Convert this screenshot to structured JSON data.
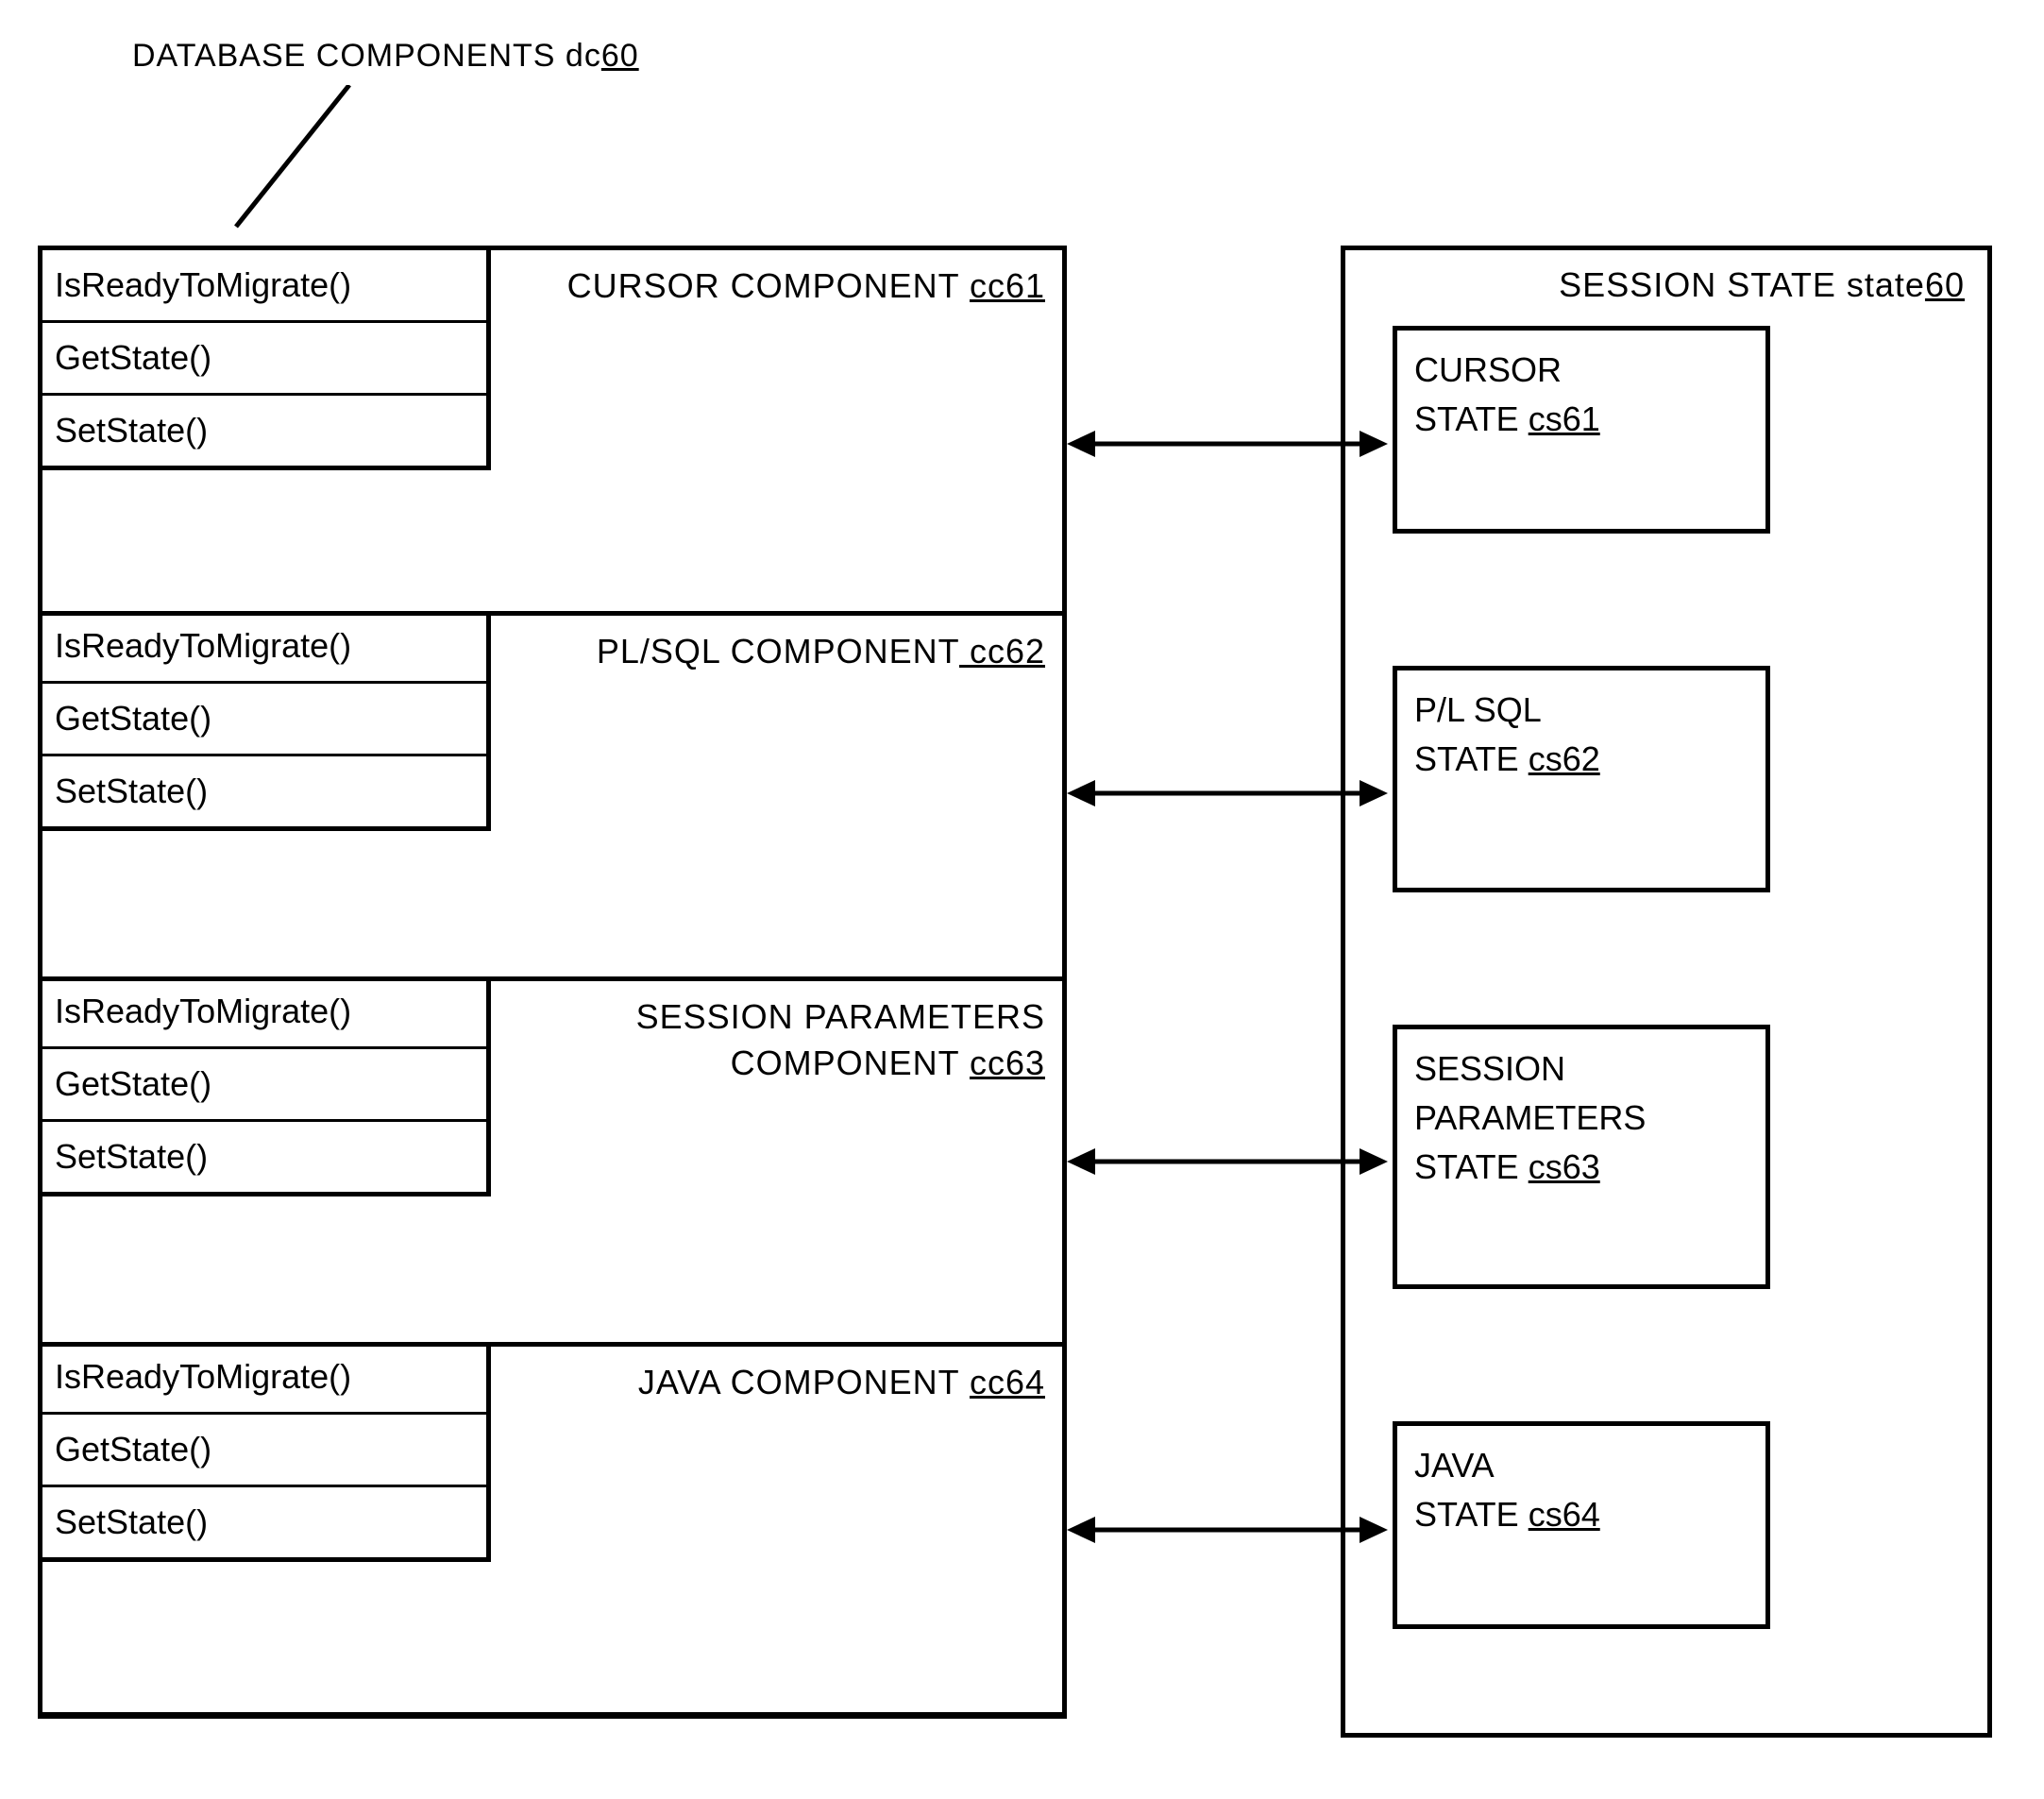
{
  "header": {
    "label": "DATABASE COMPONENTS dc",
    "ref": "60"
  },
  "components": [
    {
      "title": "CURSOR COMPONENT ",
      "ref": "cc61",
      "methods": [
        "IsReadyToMigrate()",
        "GetState()",
        "SetState()"
      ]
    },
    {
      "title": "PL/SQL COMPONENT",
      "ref": " cc62",
      "methods": [
        "IsReadyToMigrate()",
        "GetState()",
        "SetState()"
      ]
    },
    {
      "title_line1": "SESSION PARAMETERS",
      "title_line2": "COMPONENT ",
      "ref": "cc63",
      "methods": [
        "IsReadyToMigrate()",
        "GetState()",
        "SetState()"
      ]
    },
    {
      "title": "JAVA COMPONENT  ",
      "ref": "cc64",
      "methods": [
        "IsReadyToMigrate()",
        "GetState()",
        "SetState()"
      ]
    }
  ],
  "session": {
    "title": "SESSION  STATE state",
    "ref": "60",
    "states": [
      {
        "line1": "CURSOR",
        "line2": "STATE ",
        "ref": "cs61"
      },
      {
        "line1": "P/L SQL",
        "line2": "STATE ",
        "ref": "cs62"
      },
      {
        "line1": "SESSION",
        "line2": "PARAMETERS",
        "line3": "STATE ",
        "ref": "cs63"
      },
      {
        "line1": "JAVA",
        "line2": "STATE ",
        "ref": "cs64"
      }
    ]
  }
}
